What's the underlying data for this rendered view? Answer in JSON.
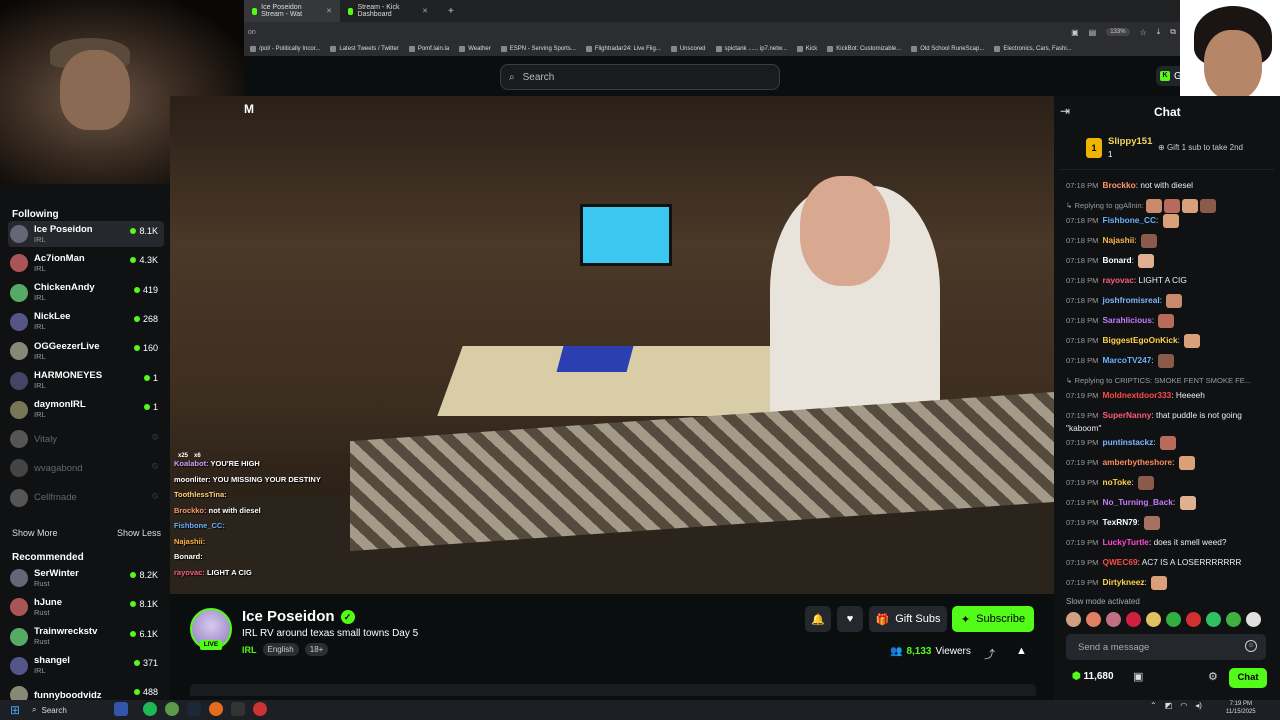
{
  "browser": {
    "tabs": [
      {
        "label": "Ice Poseidon Stream - Wat",
        "active": true
      },
      {
        "label": "Stream - Kick Dashboard",
        "active": false
      }
    ],
    "new_tab": "+",
    "address_fragment": "on",
    "zoom": "133%",
    "bookmarks": [
      "/pol/ - Politically Incor...",
      "Latest Tweets / Twitter",
      "Pomf.lain.la",
      "Weather",
      "ESPN - Serving Sports...",
      "Flightradar24: Live Flig...",
      "Unscored",
      "spictank ...... ip7.netw...",
      "Kick",
      "KickBot: Customizable...",
      "Old School RuneScap...",
      "Electronics, Cars, Fashi..."
    ]
  },
  "header": {
    "search_placeholder": "Search",
    "get_label": "Get",
    "video_title_fragment": "M"
  },
  "sidebar": {
    "following_title": "Following",
    "following": [
      {
        "name": "Ice Poseidon",
        "category": "IRL",
        "viewers": "8.1K",
        "online": true,
        "active": true
      },
      {
        "name": "Ac7ionMan",
        "category": "IRL",
        "viewers": "4.3K",
        "online": true
      },
      {
        "name": "ChickenAndy",
        "category": "IRL",
        "viewers": "419",
        "online": true
      },
      {
        "name": "NickLee",
        "category": "IRL",
        "viewers": "268",
        "online": true
      },
      {
        "name": "OGGeezerLive",
        "category": "IRL",
        "viewers": "160",
        "online": true
      },
      {
        "name": "HARMONEYES",
        "category": "IRL",
        "viewers": "1",
        "online": true
      },
      {
        "name": "daymonIRL",
        "category": "IRL",
        "viewers": "1",
        "online": true
      },
      {
        "name": "Vitaly",
        "category": "",
        "viewers": "",
        "online": false
      },
      {
        "name": "wvagabond",
        "category": "",
        "viewers": "",
        "online": false
      },
      {
        "name": "Cellfmade",
        "category": "",
        "viewers": "",
        "online": false
      }
    ],
    "show_more": "Show More",
    "show_less": "Show Less",
    "recommended_title": "Recommended",
    "recommended": [
      {
        "name": "SerWinter",
        "category": "Rust",
        "viewers": "8.2K"
      },
      {
        "name": "hJune",
        "category": "Rust",
        "viewers": "8.1K"
      },
      {
        "name": "Trainwreckstv",
        "category": "Rust",
        "viewers": "6.1K"
      },
      {
        "name": "shangel",
        "category": "IRL",
        "viewers": "371"
      },
      {
        "name": "funnyboodvidz",
        "category": "",
        "viewers": "488"
      }
    ]
  },
  "overlay_chat": [
    {
      "user": "Koalabot:",
      "text": "YOU'RE HIGH",
      "color": "#c9a0ff"
    },
    {
      "user": "moonliter:",
      "text": "YOU MISSING YOUR DESTINY",
      "color": "#ffffff"
    },
    {
      "user": "ToothlessTina:",
      "text": "",
      "color": "#ffd37a"
    },
    {
      "user": "Brockko:",
      "text": "not with diesel",
      "color": "#ff9a6a"
    },
    {
      "user": "Fishbone_CC:",
      "text": "",
      "color": "#6ab0ff"
    },
    {
      "user": "Najashii:",
      "text": "",
      "color": "#ffb347"
    },
    {
      "user": "Bonard:",
      "text": "",
      "color": "#ffffff"
    },
    {
      "user": "rayovac:",
      "text": "LIGHT A CIG",
      "color": "#ff5a7a"
    }
  ],
  "overlay_badges": [
    "x25",
    "x6"
  ],
  "stream": {
    "streamer": "Ice Poseidon",
    "live_label": "LIVE",
    "title": "IRL RV around texas small towns Day 5",
    "category": "IRL",
    "tags": [
      "English",
      "18+"
    ],
    "viewers": "8,133",
    "viewers_label": "Viewers",
    "gift_label": "Gift Subs",
    "subscribe_label": "Subscribe"
  },
  "chat": {
    "title": "Chat",
    "pinned": {
      "rank": "1",
      "user": "Slippy151",
      "count": "1",
      "gift_text": "Gift 1 sub to take 2nd"
    },
    "messages": [
      {
        "time": "07:18 PM",
        "user": "Brockko",
        "color": "#ff9a6a",
        "text": "not with diesel"
      },
      {
        "reply": "Replying to ggAllnin:",
        "emotes": 4
      },
      {
        "time": "07:18 PM",
        "user": "Fishbone_CC",
        "color": "#6ab0ff",
        "text": "",
        "emotes": 1
      },
      {
        "time": "07:18 PM",
        "user": "Najashii",
        "color": "#ffb347",
        "text": "",
        "emotes": 1
      },
      {
        "time": "07:18 PM",
        "user": "Bonard",
        "color": "#ffffff",
        "text": "",
        "emotes": 1
      },
      {
        "time": "07:18 PM",
        "user": "rayovac",
        "color": "#ff5a7a",
        "text": "LIGHT A CIG"
      },
      {
        "time": "07:18 PM",
        "user": "joshfromisreal",
        "color": "#7ab8ff",
        "text": "",
        "emotes": 1
      },
      {
        "time": "07:18 PM",
        "user": "Sarahlicious",
        "color": "#c77aff",
        "text": "",
        "emotes": 1
      },
      {
        "time": "07:18 PM",
        "user": "BiggestEgoOnKick",
        "color": "#ffd24a",
        "text": "",
        "emotes": 1
      },
      {
        "time": "07:18 PM",
        "user": "MarcoTV247",
        "color": "#6ab0ff",
        "text": "",
        "emotes": 1
      },
      {
        "reply": "Replying to CRIPTICS: SMOKE FENT SMOKE FE..."
      },
      {
        "time": "07:19 PM",
        "user": "Moldnextdoor333",
        "color": "#ff4a4a",
        "text": "Heeeeh"
      },
      {
        "time": "07:19 PM",
        "user": "SuperNanny",
        "color": "#ff5a7a",
        "text": "that puddle is not going \"kaboom\""
      },
      {
        "time": "07:19 PM",
        "user": "puntinstackz",
        "color": "#7ab8ff",
        "text": "",
        "emotes": 1
      },
      {
        "time": "07:19 PM",
        "user": "amberbytheshore",
        "color": "#ff8a5a",
        "text": "",
        "emotes": 1
      },
      {
        "time": "07:19 PM",
        "user": "noToke",
        "color": "#ffd24a",
        "text": "",
        "emotes": 1
      },
      {
        "time": "07:19 PM",
        "user": "No_Turning_Back",
        "color": "#c77aff",
        "text": "",
        "emotes": 1
      },
      {
        "time": "07:19 PM",
        "user": "TexRN79",
        "color": "#ffffff",
        "text": "",
        "emotes": 1
      },
      {
        "time": "07:19 PM",
        "user": "LuckyTurtle",
        "color": "#ff4ad0",
        "text": "does it smell weed?"
      },
      {
        "time": "07:19 PM",
        "user": "QWEC69",
        "color": "#ff4a4a",
        "text": "AC7 IS A LOSERRRRRRR"
      },
      {
        "time": "07:19 PM",
        "user": "Dirtykneez",
        "color": "#ffd24a",
        "text": "",
        "emotes": 1
      }
    ],
    "slow_mode": "Slow mode activated",
    "input_placeholder": "Send a message",
    "points": "11,680",
    "send_label": "Chat"
  },
  "taskbar": {
    "search_label": "Search",
    "time": "7:19 PM",
    "date": "11/15/2025"
  },
  "colors": {
    "kick_green": "#53fc18",
    "background": "#0b0e0f",
    "panel": "#0f1113"
  }
}
